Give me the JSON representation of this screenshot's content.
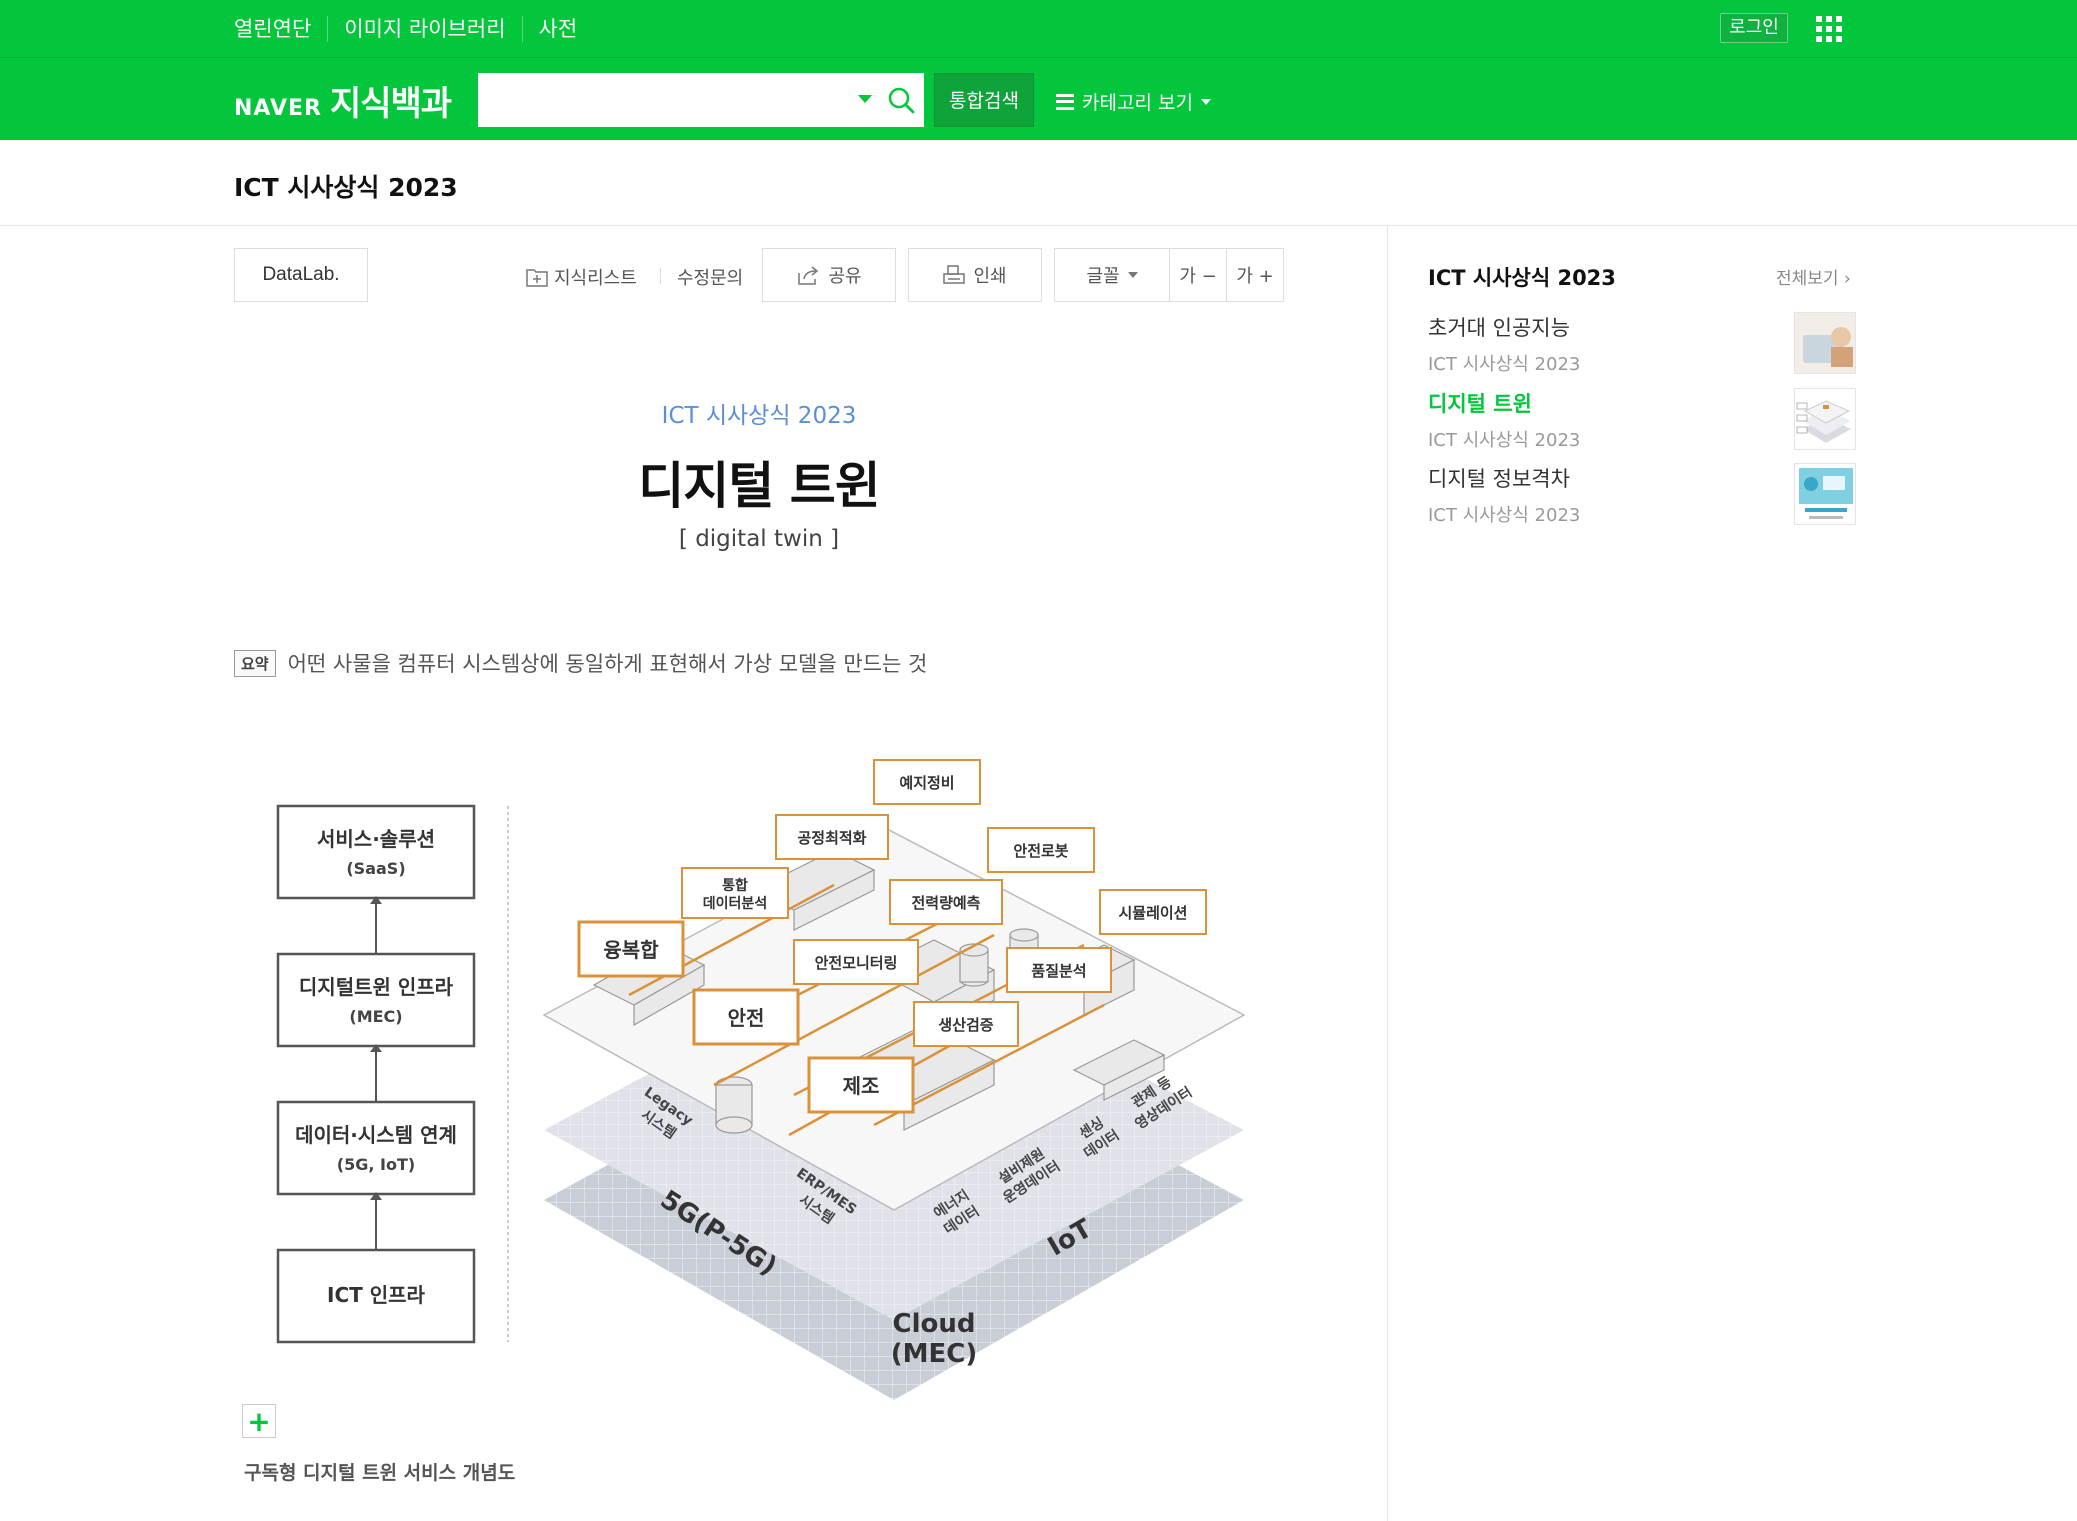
{
  "topnav": {
    "items": [
      "열린연단",
      "이미지 라이브러리",
      "사전"
    ],
    "login": "로그인"
  },
  "header": {
    "logo_naver": "NAVER",
    "logo_dict": "지식백과",
    "search_placeholder": "",
    "total_search": "통합검색",
    "category_view": "카테고리 보기"
  },
  "book_title": "ICT 시사상식 2023",
  "toolbar": {
    "datalab": "DataLab.",
    "knowledge_list": "지식리스트",
    "edit_request": "수정문의",
    "share": "공유",
    "print": "인쇄",
    "font": "글꼴",
    "font_smaller": "가 −",
    "font_larger": "가 +"
  },
  "article": {
    "category": "ICT 시사상식 2023",
    "title": "디지털 트윈",
    "english": "[ digital twin ]",
    "summary_tag": "요약",
    "summary": "어떤 사물을 컴퓨터 시스템상에 동일하게 표현해서 가상 모델을 만드는 것",
    "caption": "구독형 디지털 트윈 서비스 개념도"
  },
  "figure": {
    "stack": [
      {
        "title": "서비스·솔루션",
        "sub": "(SaaS)"
      },
      {
        "title": "디지털트윈 인프라",
        "sub": "(MEC)"
      },
      {
        "title": "데이터·시스템 연계",
        "sub": "(5G, IoT)"
      },
      {
        "title": "ICT 인프라",
        "sub": ""
      }
    ],
    "labels": {
      "predictive": "예지정비",
      "process": "공정최적화",
      "safety_robot": "안전로봇",
      "integrated": "통합\n데이터분석",
      "power": "전력량예측",
      "simulation": "시뮬레이션",
      "convergence": "융복합",
      "safety_monitor": "안전모니터링",
      "quality": "품질분석",
      "safety": "안전",
      "production": "생산검증",
      "manufacturing": "제조",
      "legacy": "Legacy\n시스템",
      "erp": "ERP/MES\n시스템",
      "energy": "에너지\n데이터",
      "facility": "설비제원\n운영데이터",
      "sensing": "센싱\n데이터",
      "cctv": "관제 등\n영상데이터",
      "net5g": "5G(P-5G)",
      "iot": "IoT",
      "cloud": "Cloud",
      "mec": "(MEC)"
    }
  },
  "sidebar": {
    "title": "ICT 시사상식 2023",
    "view_all": "전체보기 ›",
    "items": [
      {
        "name": "초거대 인공지능",
        "sub": "ICT 시사상식 2023",
        "active": false
      },
      {
        "name": "디지털 트윈",
        "sub": "ICT 시사상식 2023",
        "active": true
      },
      {
        "name": "디지털 정보격차",
        "sub": "ICT 시사상식 2023",
        "active": false
      }
    ]
  },
  "colors": {
    "brand": "#03c63c",
    "accent_orange": "#d9923a",
    "category_blue": "#5b8ed6"
  }
}
